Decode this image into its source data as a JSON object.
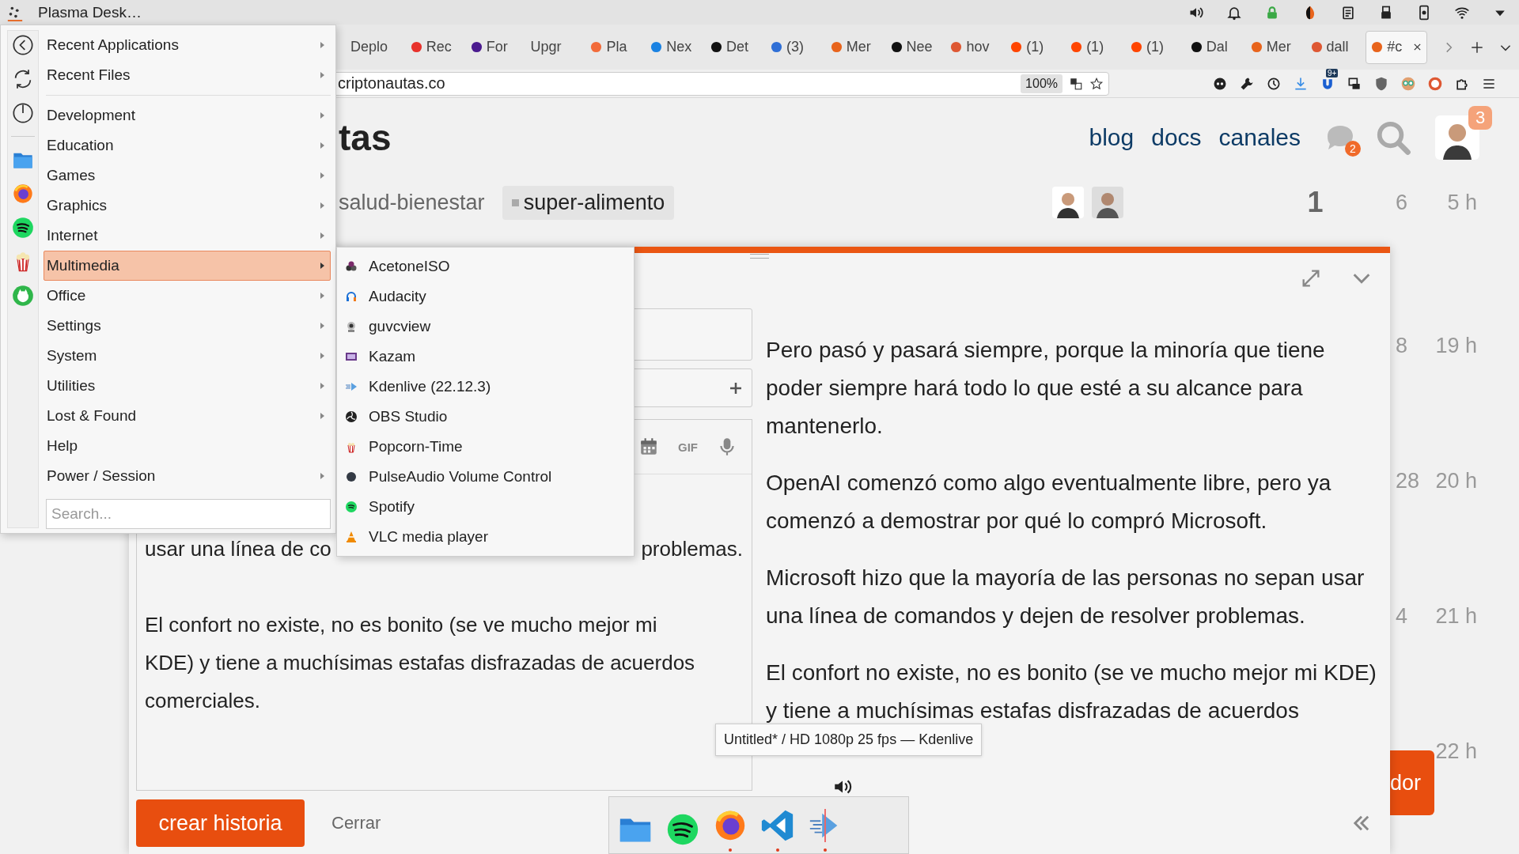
{
  "panel": {
    "title": "Plasma Desk…"
  },
  "browser": {
    "tabs": [
      {
        "label": "Deplo",
        "selected": false
      },
      {
        "label": "Rec",
        "color": "#e8322c",
        "selected": false
      },
      {
        "label": "For",
        "color": "#4b1b8f",
        "selected": false
      },
      {
        "label": "Upgr",
        "selected": false
      },
      {
        "label": "Pla",
        "color": "#f26b3a",
        "selected": false
      },
      {
        "label": "Nex",
        "color": "#1a82e2",
        "selected": false
      },
      {
        "label": "Det",
        "color": "#111111",
        "selected": false
      },
      {
        "label": "(3)",
        "color": "#2f6fd6",
        "selected": false
      },
      {
        "label": "Mer",
        "color": "#e8641c",
        "selected": false
      },
      {
        "label": "Nee",
        "color": "#111111",
        "selected": false
      },
      {
        "label": "hov",
        "color": "#de5833",
        "selected": false
      },
      {
        "label": "(1)",
        "color": "#ff4500",
        "selected": false
      },
      {
        "label": "(1)",
        "color": "#ff4500",
        "selected": false
      },
      {
        "label": "(1)",
        "color": "#ff4500",
        "selected": false
      },
      {
        "label": "Dal",
        "color": "#111111",
        "selected": false
      },
      {
        "label": "Mer",
        "color": "#e8641c",
        "selected": false
      },
      {
        "label": "dall",
        "color": "#de5833",
        "selected": false
      },
      {
        "label": "#c",
        "color": "#e8641c",
        "selected": true
      }
    ],
    "url": "criptonautas.co",
    "zoom": "100%",
    "extension_badge": "9+"
  },
  "page": {
    "title": "tas",
    "nav": [
      "blog",
      "docs",
      "canales"
    ],
    "chat_badge": "2",
    "avatar_badge": "3",
    "topics": [
      {
        "tags": [
          "salud-bienestar",
          "super-alimento"
        ],
        "replies": "1",
        "views": "6",
        "activity": "5 h"
      },
      {
        "views": "8",
        "activity": "19 h"
      },
      {
        "views": "28",
        "activity": "20 h"
      },
      {
        "views": "4",
        "activity": "21 h"
      },
      {
        "activity": "22 h"
      }
    ],
    "action_button": "dor"
  },
  "composer": {
    "editor_fragments": [
      "usar una línea de co",
      "problemas."
    ],
    "editor_paragraph": "El confort no existe, no es bonito (se ve mucho mejor mi KDE) y tiene a muchísimas estafas disfrazadas de acuerdos comerciales.",
    "gif": "GIF",
    "preview": [
      "Pero pasó y pasará siempre, porque la minoría que tiene poder siempre hará todo lo que esté a su alcance para mantenerlo.",
      "OpenAI comenzó como algo eventualmente libre, pero ya comenzó a demostrar por qué lo compró Microsoft.",
      "Microsoft hizo que la mayoría de las personas no sepan usar una línea de comandos y dejen de resolver problemas.",
      "El confort no existe, no es bonito (se ve mucho mejor mi KDE) y tiene a muchísimas estafas disfrazadas de acuerdos"
    ],
    "submit": "crear historia",
    "cancel": "Cerrar"
  },
  "menu": {
    "recent_items": [
      {
        "label": "Recent Applications",
        "submenu": true,
        "selected": false
      },
      {
        "label": "Recent Files",
        "submenu": true,
        "selected": false
      }
    ],
    "categories": [
      {
        "label": "Development",
        "submenu": true,
        "selected": false
      },
      {
        "label": "Education",
        "submenu": true,
        "selected": false
      },
      {
        "label": "Games",
        "submenu": true,
        "selected": false
      },
      {
        "label": "Graphics",
        "submenu": true,
        "selected": false
      },
      {
        "label": "Internet",
        "submenu": true,
        "selected": false
      },
      {
        "label": "Multimedia",
        "submenu": true,
        "selected": true
      },
      {
        "label": "Office",
        "submenu": true,
        "selected": false
      },
      {
        "label": "Settings",
        "submenu": true,
        "selected": false
      },
      {
        "label": "System",
        "submenu": true,
        "selected": false
      },
      {
        "label": "Utilities",
        "submenu": true,
        "selected": false
      },
      {
        "label": "Lost & Found",
        "submenu": true,
        "selected": false
      },
      {
        "label": "Help",
        "submenu": false,
        "selected": false
      },
      {
        "label": "Power / Session",
        "submenu": true,
        "selected": false
      }
    ],
    "search": {
      "placeholder": "Search..."
    }
  },
  "submenu": {
    "items": [
      "AcetoneISO",
      "Audacity",
      "guvcview",
      "Kazam",
      "Kdenlive (22.12.3)",
      "OBS Studio",
      "Popcorn-Time",
      "PulseAudio Volume Control",
      "Spotify",
      "VLC media player"
    ]
  },
  "tooltip": "Untitled* / HD 1080p 25 fps — Kdenlive"
}
